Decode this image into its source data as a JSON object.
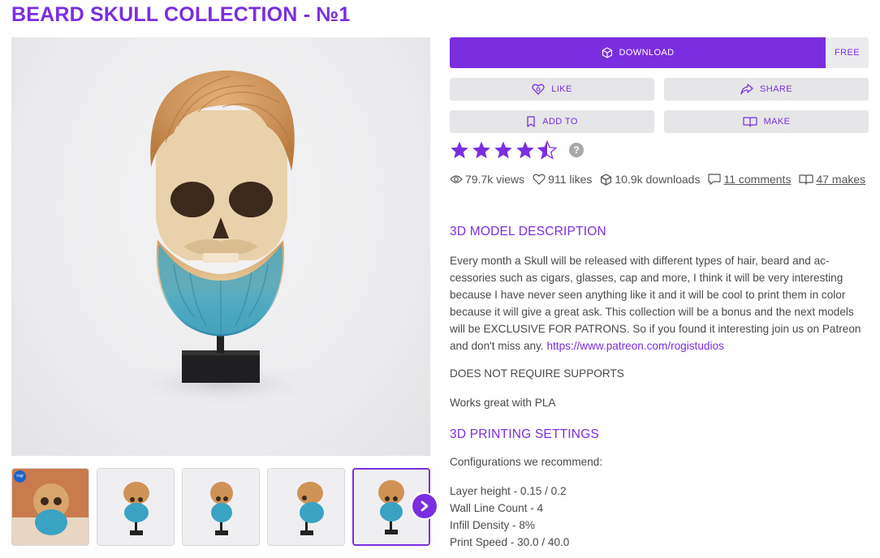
{
  "title": "BEARD SKULL COLLECTION - №1",
  "actions": {
    "download_label": "DOWNLOAD",
    "price_label": "FREE",
    "like_label": "LIKE",
    "share_label": "SHARE",
    "add_to_label": "ADD TO",
    "make_label": "MAKE"
  },
  "rating": {
    "value": 4.5,
    "max": 5,
    "help": "?"
  },
  "stats": {
    "views": "79.7k views",
    "likes": "911 likes",
    "downloads": "10.9k downloads",
    "comments": "11 comments",
    "makes": "47 makes"
  },
  "description": {
    "heading": "3D MODEL DESCRIPTION",
    "body": "Every month a Skull will be released with different types of hair, beard and ac-cessories such as cigars, glasses, cap and more, I think it will be very interesting because I have never seen anything like it and it will be cool to print them in color because it will give a great ask. This collection will be a bonus and the next models will be EXCLUSIVE FOR PATRONS. So if you found it interesting join us on Patreon and don't miss any.",
    "link": "https://www.patreon.com/rogistudios",
    "supports": "DOES NOT REQUIRE SUPPORTS",
    "material": "Works great with PLA"
  },
  "settings": {
    "heading": "3D PRINTING SETTINGS",
    "intro": "Configurations we recommend:",
    "items": [
      "Layer height - 0.15 / 0.2",
      "Wall Line Count - 4",
      "Infill Density - 8%",
      "Print Speed - 30.0 / 40.0"
    ]
  },
  "thumbnails": {
    "badge": "rogi"
  },
  "colors": {
    "accent": "#7a2ee0",
    "button_bg": "#e6e6e8",
    "hair": "#c8935a",
    "beard": "#3a9fb8"
  }
}
